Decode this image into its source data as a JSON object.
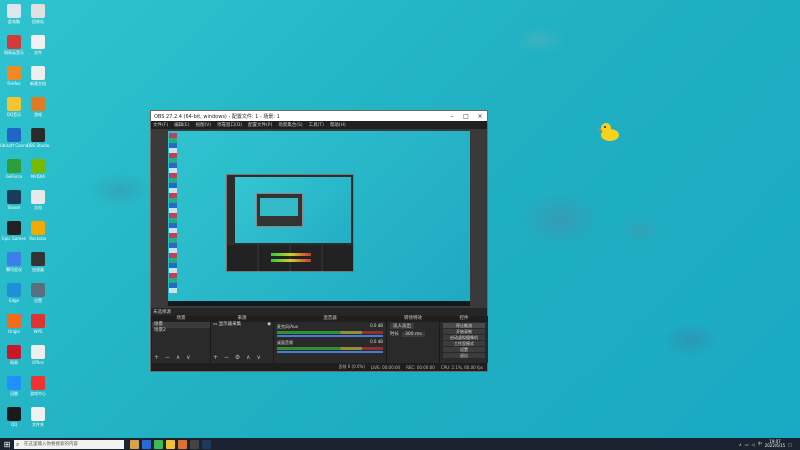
{
  "desktop": {
    "icons": [
      {
        "label": "此电脑",
        "color": "#dde6ef"
      },
      {
        "label": "回收站",
        "color": "#e0e0e0"
      },
      {
        "label": "网易云音乐",
        "color": "#d33a3a"
      },
      {
        "label": "文件",
        "color": "#f0f0f0"
      },
      {
        "label": "Firefox",
        "color": "#f08a24"
      },
      {
        "label": "新建文档",
        "color": "#eeeeee"
      },
      {
        "label": "QQ音乐",
        "color": "#f4c430"
      },
      {
        "label": "游戏",
        "color": "#e07b24"
      },
      {
        "label": "Ubisoft Connect",
        "color": "#1f66c8"
      },
      {
        "label": "OBS Studio",
        "color": "#2a2a2a"
      },
      {
        "label": "GeForce",
        "color": "#2e9e3a"
      },
      {
        "label": "NVIDIA",
        "color": "#76b900"
      },
      {
        "label": "Steam",
        "color": "#1b3a5c"
      },
      {
        "label": "文档",
        "color": "#e8e8e8"
      },
      {
        "label": "Epic Games",
        "color": "#222222"
      },
      {
        "label": "Rockstar",
        "color": "#f2a900"
      },
      {
        "label": "腾讯会议",
        "color": "#3d7ee8"
      },
      {
        "label": "加速器",
        "color": "#333333"
      },
      {
        "label": "Edge",
        "color": "#1f8fd6"
      },
      {
        "label": "设置",
        "color": "#5a6f80"
      },
      {
        "label": "Origin",
        "color": "#f26b1d"
      },
      {
        "label": "WPS",
        "color": "#d33"
      },
      {
        "label": "网易",
        "color": "#c8162a"
      },
      {
        "label": "Office",
        "color": "#eeeeee"
      },
      {
        "label": "迅雷",
        "color": "#1e90ff"
      },
      {
        "label": "游戏中心",
        "color": "#e33"
      },
      {
        "label": "QQ",
        "color": "#1a1a1a"
      },
      {
        "label": "文件夹",
        "color": "#f0f0f0"
      }
    ]
  },
  "obs": {
    "title": "OBS 27.2.4 (64-bit, windows) - 配置文件: 1 - 场景: 1",
    "menu": [
      "文件(F)",
      "编辑(E)",
      "视图(V)",
      "停靠窗口(D)",
      "配置文件(P)",
      "场景集合(S)",
      "工具(T)",
      "帮助(H)"
    ],
    "scene_label": "未选择源",
    "docks": {
      "scenes": {
        "header": "场景",
        "items": [
          "场景",
          "场景2"
        ]
      },
      "sources": {
        "header": "来源",
        "items": [
          "显示器采集"
        ]
      },
      "mixer": {
        "header": "混音器",
        "rows": [
          {
            "name": "麦克风/Aux",
            "level": "0.0 dB"
          },
          {
            "name": "桌面音频",
            "level": "0.0 dB"
          }
        ]
      },
      "transitions": {
        "header": "转场特效",
        "type": "淡入淡出",
        "duration_label": "时长",
        "duration": "300 ms"
      },
      "controls": {
        "header": "控件",
        "buttons": [
          "停止推流",
          "开始录制",
          "启动虚拟摄像机",
          "工作室模式",
          "设置",
          "退出"
        ]
      }
    },
    "status": [
      "丢帧 0 (0.0%)",
      "LIVE: 00:00:00",
      "REC: 00:00:00",
      "CPU: 2.1%, 60.00 fps"
    ]
  },
  "taskbar": {
    "search_placeholder": "在这里输入你要搜索的内容",
    "clock_time": "19:07",
    "clock_date": "2022/6/15",
    "tray_text": "中",
    "icons": [
      "#d8a24a",
      "#2a6ad8",
      "#3dbb55",
      "#f0c030",
      "#e07030",
      "#444444",
      "#1b3a5c"
    ]
  }
}
